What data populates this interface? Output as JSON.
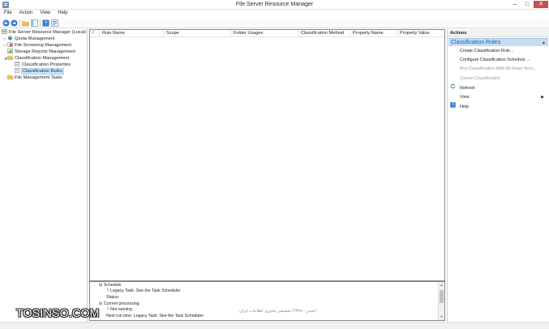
{
  "window": {
    "title": "File Server Resource Manager",
    "minimize": "–",
    "maximize": "□",
    "close": "✕"
  },
  "menu": [
    "File",
    "Action",
    "View",
    "Help"
  ],
  "toolbar": [
    "back-arrow-icon",
    "forward-arrow-icon",
    "folder-up-icon",
    "console-tree-icon",
    "help-icon",
    "properties-icon"
  ],
  "tree": {
    "root": "File Server Resource Manager (Local)",
    "items": [
      {
        "label": "Quota Management",
        "icon": "quota-icon",
        "expander": "▷"
      },
      {
        "label": "File Screening Management",
        "icon": "file-screen-icon",
        "expander": "▷"
      },
      {
        "label": "Storage Reports Management",
        "icon": "report-icon",
        "expander": ""
      },
      {
        "label": "Classification Management",
        "icon": "classification-folder-icon",
        "expander": "◢"
      },
      {
        "label": "Classification Properties",
        "icon": "properties-list-icon",
        "expander": ""
      },
      {
        "label": "Classification Rules",
        "icon": "rules-list-icon",
        "expander": ""
      },
      {
        "label": "File Management Tasks",
        "icon": "tasks-icon",
        "expander": ""
      }
    ]
  },
  "grid": {
    "columns": [
      "/",
      "Rule Name",
      "Scope",
      "Folder Usages",
      "Classification Method",
      "Property Name",
      "Property Value"
    ]
  },
  "details": {
    "lines": [
      "Schedule",
      "Legacy Task: See the Task Scheduler",
      "Status:",
      "Current processing",
      "Not running",
      "Next run time: Legacy Task: See the Task Scheduler"
    ],
    "expanders": [
      "⊟",
      "",
      "",
      "⊟",
      "",
      ""
    ]
  },
  "actions": {
    "header": "Actions",
    "section": "Classification Rules",
    "items": [
      {
        "label": "Create Classification Rule...",
        "icon": "",
        "enabled": true
      },
      {
        "label": "Configure Classification Schedule ...",
        "icon": "",
        "enabled": true
      },
      {
        "label": "Run Classification With All Rules Now...",
        "icon": "",
        "enabled": false
      },
      {
        "label": "Cancel Classification",
        "icon": "",
        "enabled": false
      },
      {
        "label": "Refresh",
        "icon": "refresh-icon",
        "enabled": true
      },
      {
        "label": "View",
        "icon": "",
        "enabled": true,
        "submenu": "▶"
      },
      {
        "label": "Help",
        "icon": "help-icon",
        "enabled": true
      }
    ]
  },
  "watermark": {
    "brand": "TOSINSO.COM",
    "sub": "تخصصی فناوری اطلاعات ایران ITPro - انجمن"
  },
  "colors": {
    "selection": "#cce8ff",
    "actions_section": "#c5dcf3",
    "close_button": "#c75050",
    "link": "#1a5fa8"
  }
}
